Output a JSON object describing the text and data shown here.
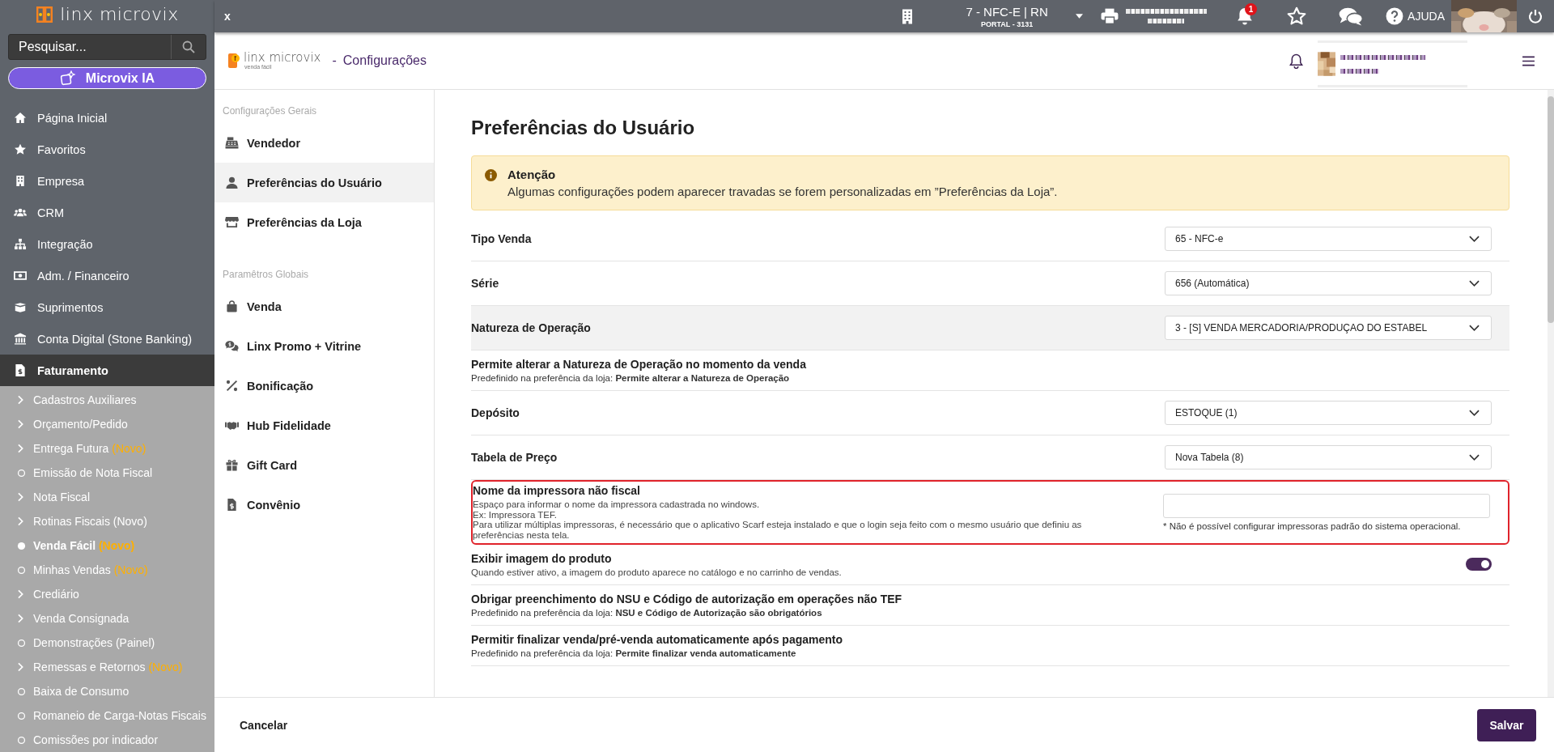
{
  "sidebar": {
    "logo": "linx microvix",
    "search": {
      "placeholder": "Pesquisar..."
    },
    "ai_button": "Microvix IA",
    "items": [
      {
        "label": "Página Inicial",
        "expanded": false
      },
      {
        "label": "Favoritos",
        "expanded": false
      },
      {
        "label": "Empresa",
        "expanded": false
      },
      {
        "label": "CRM",
        "expanded": false
      },
      {
        "label": "Integração",
        "expanded": false
      },
      {
        "label": "Adm. / Financeiro",
        "expanded": false
      },
      {
        "label": "Suprimentos",
        "expanded": false
      },
      {
        "label": "Conta Digital (Stone Banking)",
        "expanded": false
      },
      {
        "label": "Faturamento",
        "expanded": true,
        "children": [
          {
            "label": "Cadastros Auxiliares",
            "kind": "folder",
            "selected": false
          },
          {
            "label": "Orçamento/Pedido",
            "kind": "folder",
            "selected": false
          },
          {
            "label": "Entrega Futura",
            "badge": "(Novo)",
            "kind": "folder",
            "selected": false
          },
          {
            "label": "Emissão de Nota Fiscal",
            "kind": "page",
            "selected": false
          },
          {
            "label": "Nota Fiscal",
            "kind": "folder",
            "selected": false
          },
          {
            "label": "Rotinas Fiscais (Novo)",
            "kind": "folder",
            "selected": false
          },
          {
            "label": "Venda Fácil",
            "badge": "(Novo)",
            "kind": "page",
            "selected": true
          },
          {
            "label": "Minhas Vendas",
            "badge": "(Novo)",
            "kind": "page",
            "selected": false
          },
          {
            "label": "Crediário",
            "kind": "folder",
            "selected": false
          },
          {
            "label": "Venda Consignada",
            "kind": "folder",
            "selected": false
          },
          {
            "label": "Demonstrações (Painel)",
            "kind": "page",
            "selected": false
          },
          {
            "label": "Remessas e Retornos",
            "badge": "(Novo)",
            "kind": "folder",
            "selected": false
          },
          {
            "label": "Baixa de Consumo",
            "kind": "page",
            "selected": false
          },
          {
            "label": "Romaneio de Carga-Notas Fiscais",
            "kind": "page",
            "selected": false
          },
          {
            "label": "Comissões por indicador",
            "kind": "page",
            "selected": false
          }
        ]
      }
    ]
  },
  "topbar": {
    "close": "x",
    "store": "7 - NFC-E | RN",
    "portal": "PORTAL - 3131",
    "notifications": "1",
    "help": "AJUDA"
  },
  "header": {
    "logo": "linx microvix",
    "logo_tagline": "venda fácil",
    "separator": "-",
    "title": "Configurações"
  },
  "config_nav": [
    {
      "heading": "Configurações Gerais",
      "items": [
        {
          "label": "Vendedor",
          "selected": false
        },
        {
          "label": "Preferências do Usuário",
          "selected": true
        },
        {
          "label": "Preferências da Loja",
          "selected": false
        }
      ]
    },
    {
      "heading": "Paramêtros Globais",
      "items": [
        {
          "label": "Venda",
          "selected": false
        },
        {
          "label": "Linx Promo + Vitrine",
          "selected": false
        },
        {
          "label": "Bonificação",
          "selected": false
        },
        {
          "label": "Hub Fidelidade",
          "selected": false
        },
        {
          "label": "Gift Card",
          "selected": false
        },
        {
          "label": "Convênio",
          "selected": false
        }
      ]
    }
  ],
  "content": {
    "title": "Preferências do Usuário",
    "alert": {
      "title": "Atenção",
      "message": "Algumas configurações podem aparecer travadas se forem personalizadas em ”Preferências da Loja”."
    },
    "settings": [
      {
        "kind": "select",
        "label": "Tipo Venda",
        "value": "65 - NFC-e",
        "hovered": false
      },
      {
        "kind": "select",
        "label": "Série",
        "value": "656 (Automática)",
        "hovered": false
      },
      {
        "kind": "select",
        "label": "Natureza de Operação",
        "value": "3 - [S] VENDA MERCADORIA/PRODUÇAO DO ESTABEL",
        "hovered": true
      },
      {
        "kind": "info",
        "label": "Permite alterar a Natureza de Operação no momento da venda",
        "note": "Predefinido na preferência da loja: **Permite alterar a Natureza de Operação**"
      },
      {
        "kind": "select",
        "label": "Depósito",
        "value": "ESTOQUE (1)",
        "hovered": false
      },
      {
        "kind": "select",
        "label": "Tabela de Preço",
        "value": "Nova Tabela (8)",
        "hovered": false
      },
      {
        "kind": "text",
        "label": "Nome da impressora não fiscal",
        "description": [
          "Espaço para informar o nome da impressora cadastrada no windows.",
          "Ex: Impressora TEF.",
          "Para utilizar múltiplas impressoras, é necessário que o aplicativo Scarf esteja instalado e que o login seja feito com o mesmo usuário que definiu as preferências nesta tela."
        ],
        "hint": "* Não é possível configurar impressoras padrão do sistema operacional.",
        "flagged": true
      },
      {
        "kind": "toggle",
        "label": "Exibir imagem do produto",
        "description": [
          "Quando estiver ativo, a imagem do produto aparece no catálogo e no carrinho de vendas."
        ],
        "on": true
      },
      {
        "kind": "info",
        "label": "Obrigar preenchimento do NSU e Código de autorização em operações não TEF",
        "note": "Predefinido na preferência da loja: **NSU e Código de Autorização são obrigatórios**"
      },
      {
        "kind": "info",
        "label": "Permitir finalizar venda/pré-venda automaticamente após pagamento",
        "note": "Predefinido na preferência da loja: **Permite finalizar venda automaticamente**"
      }
    ]
  },
  "footer": {
    "cancel": "Cancelar",
    "save": "Salvar"
  }
}
